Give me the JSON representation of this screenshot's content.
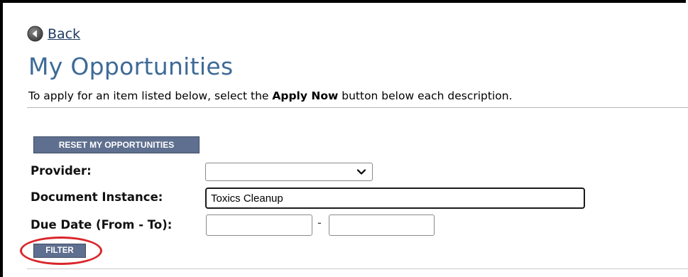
{
  "nav": {
    "back_label": "Back"
  },
  "page": {
    "title": "My Opportunities",
    "instructions_prefix": "To apply for an item listed below, select the ",
    "instructions_bold": "Apply Now",
    "instructions_suffix": " button below each description."
  },
  "buttons": {
    "reset_label": "RESET MY OPPORTUNITIES",
    "filter_label": "FILTER"
  },
  "filters": {
    "provider_label": "Provider:",
    "provider_value": "",
    "document_instance_label": "Document Instance:",
    "document_instance_value": "Toxics Cleanup",
    "due_date_label": "Due Date (From - To):",
    "due_date_from": "",
    "due_date_separator": "-",
    "due_date_to": ""
  },
  "colors": {
    "title": "#3d6a97",
    "button_bg": "#5f6f8f",
    "annotation_circle": "#d9262a"
  },
  "icons": {
    "back": "back-arrow-circle-icon",
    "select_chevron": "chevron-down-icon"
  }
}
